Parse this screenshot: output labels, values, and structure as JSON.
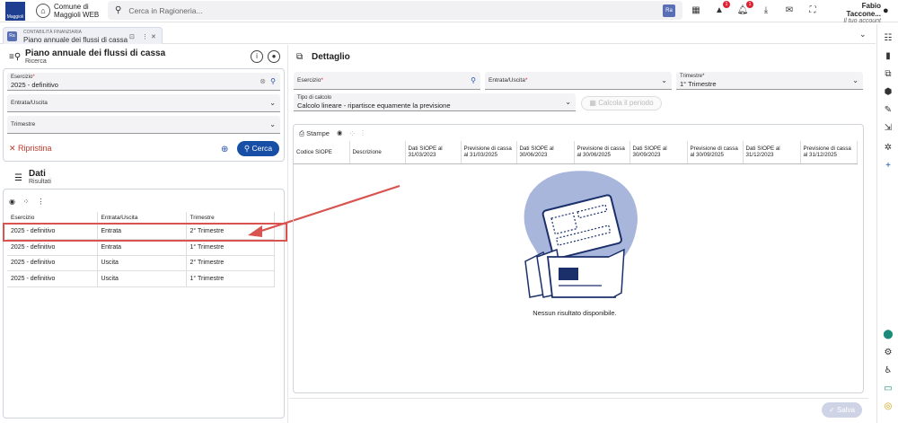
{
  "app": {
    "logo_text": "Maggioli",
    "name_line1": "Comune di",
    "name_line2": "Maggioli WEB"
  },
  "search": {
    "placeholder": "Cerca in Ragioneria..."
  },
  "notifications": {
    "warnings": "1",
    "bell": "1"
  },
  "user": {
    "name": "Fabio Taccone...",
    "subtitle": "Il tuo account"
  },
  "tab": {
    "category": "CONTABILITÀ FINANZIARIA",
    "title": "Piano annuale dei flussi di cassa",
    "icon_text": "Ra"
  },
  "left": {
    "title": "Piano annuale dei flussi di cassa",
    "subtitle": "Ricerca",
    "filters": {
      "esercizio_label": "Esercizio",
      "esercizio_value": "2025 - definitivo",
      "entrata_uscita_label": "Entrata/Uscita",
      "trimestre_label": "Trimestre"
    },
    "reset_label": "Ripristina",
    "search_label": "Cerca",
    "results_title": "Dati",
    "results_subtitle": "Risultati",
    "columns": [
      "Esercizio",
      "Entrata/Uscita",
      "Trimestre"
    ],
    "rows": [
      [
        "2025 - definitivo",
        "Entrata",
        "2° Trimestre"
      ],
      [
        "2025 - definitivo",
        "Entrata",
        "1° Trimestre"
      ],
      [
        "2025 - definitivo",
        "Uscita",
        "2° Trimestre"
      ],
      [
        "2025 - definitivo",
        "Uscita",
        "1° Trimestre"
      ]
    ]
  },
  "detail": {
    "title": "Dettaglio",
    "esercizio_label": "Esercizio",
    "entrata_uscita_label": "Entrata/Uscita",
    "trimestre_label": "Trimestre",
    "trimestre_value": "1° Trimestre",
    "tipo_calcolo_label": "Tipo di calcolo",
    "tipo_calcolo_value": "Calcolo lineare - ripartisce equamente la previsione",
    "calc_button": "Calcola il periodo",
    "stampe_label": "Stampe",
    "columns": [
      "Codice SIOPE",
      "Descrizione",
      "Dati SIOPE al 31/03/2023",
      "Previsione di cassa al 31/03/2025",
      "Dati SIOPE al 30/06/2023",
      "Previsione di cassa al 30/06/2025",
      "Dati SIOPE al 30/09/2023",
      "Previsione di cassa al 30/09/2025",
      "Dati SIOPE al 31/12/2023",
      "Previsione di cassa al 31/12/2025"
    ],
    "empty_message": "Nessun risultato disponibile.",
    "save_label": "Salva"
  },
  "colors": {
    "primary": "#174ea6",
    "danger": "#c0392b",
    "highlight": "#d9534f"
  }
}
